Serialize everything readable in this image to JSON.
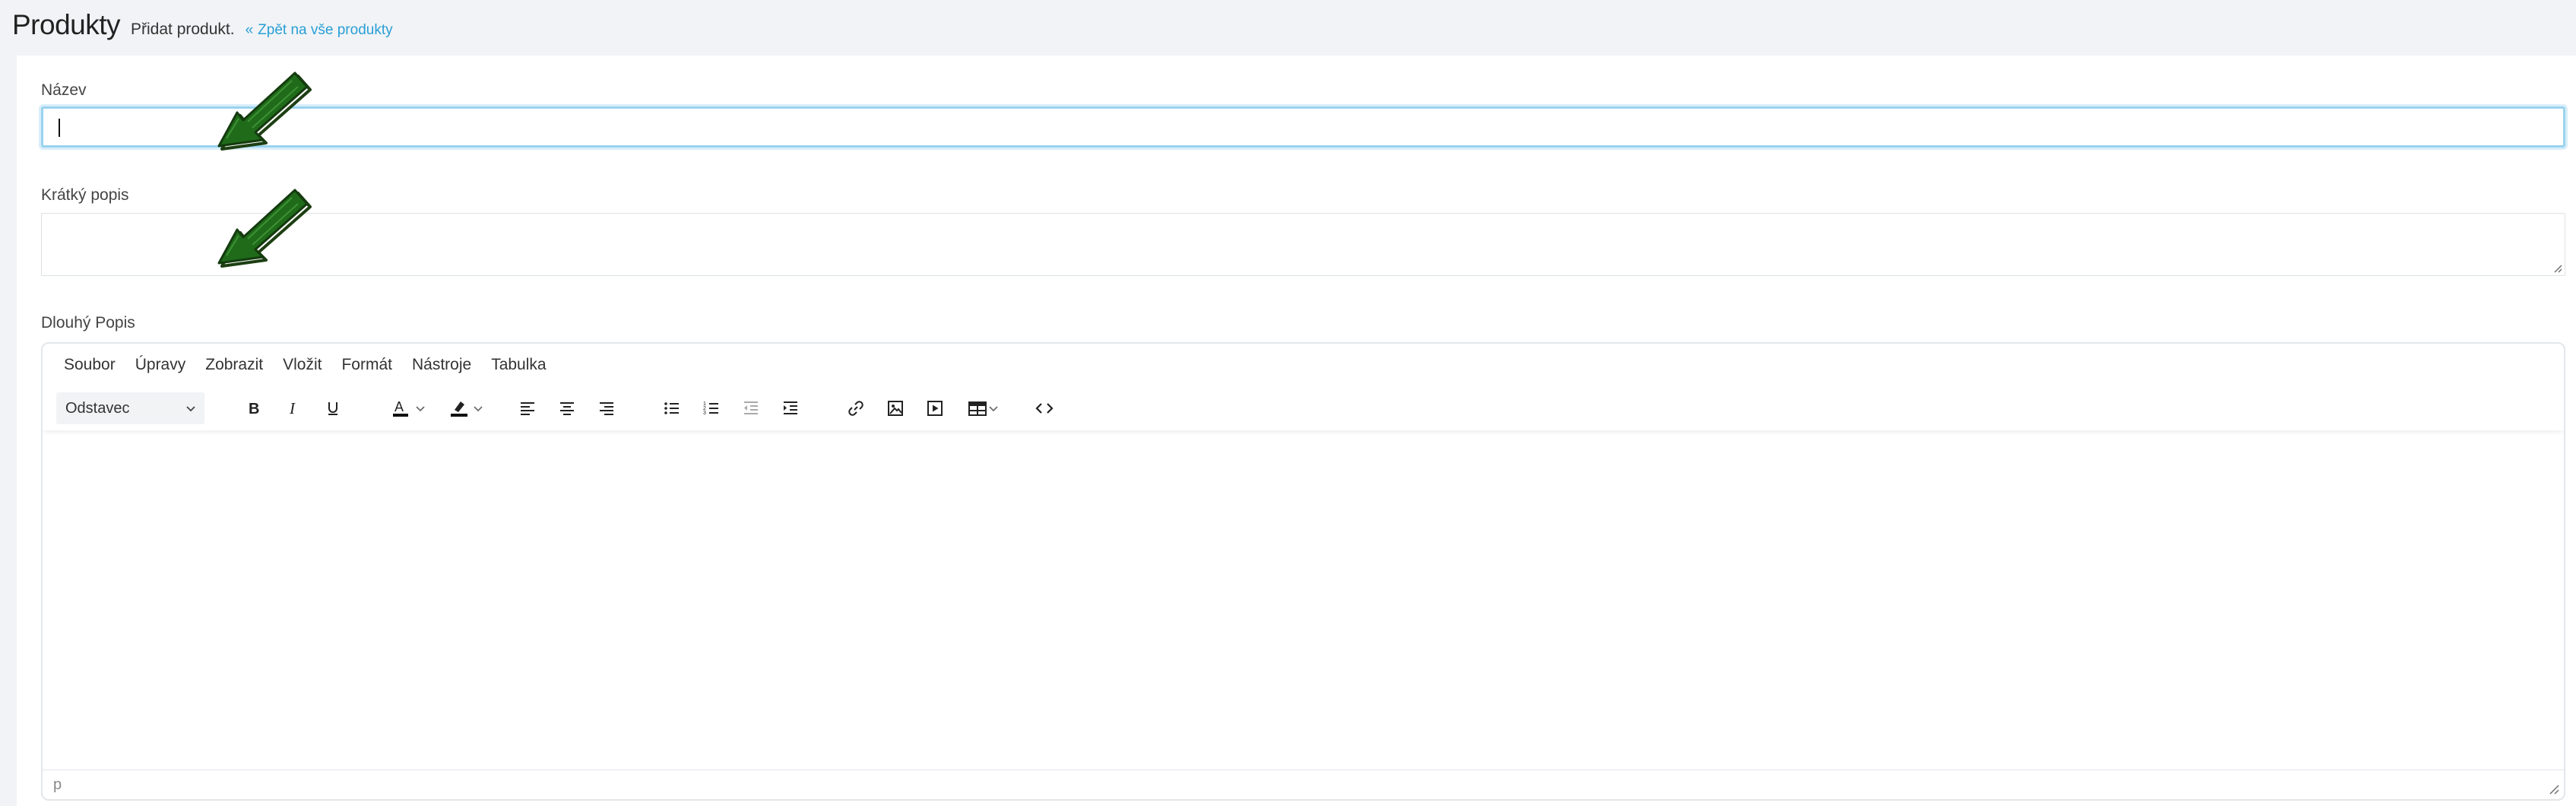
{
  "header": {
    "title": "Produkty",
    "subtitle": "Přidat produkt.",
    "back_link": "Zpět na vše produkty"
  },
  "form": {
    "name_label": "Název",
    "name_value": "",
    "short_desc_label": "Krátký popis",
    "short_desc_value": "",
    "long_desc_label": "Dlouhý Popis"
  },
  "editor": {
    "menu": [
      "Soubor",
      "Úpravy",
      "Zobrazit",
      "Vložit",
      "Formát",
      "Nástroje",
      "Tabulka"
    ],
    "block_format": "Odstavec",
    "status_path": "p",
    "toolbar_icons": [
      "bold-icon",
      "italic-icon",
      "underline-icon",
      "text-color-icon",
      "highlight-color-icon",
      "align-left-icon",
      "align-center-icon",
      "align-right-icon",
      "bullet-list-icon",
      "numbered-list-icon",
      "outdent-icon",
      "indent-icon",
      "link-icon",
      "image-icon",
      "media-icon",
      "table-icon",
      "source-code-icon"
    ]
  },
  "colors": {
    "link": "#2a9fd6",
    "focus_border": "#9ad3ee",
    "annotation_arrow": "#1f6b1a"
  }
}
